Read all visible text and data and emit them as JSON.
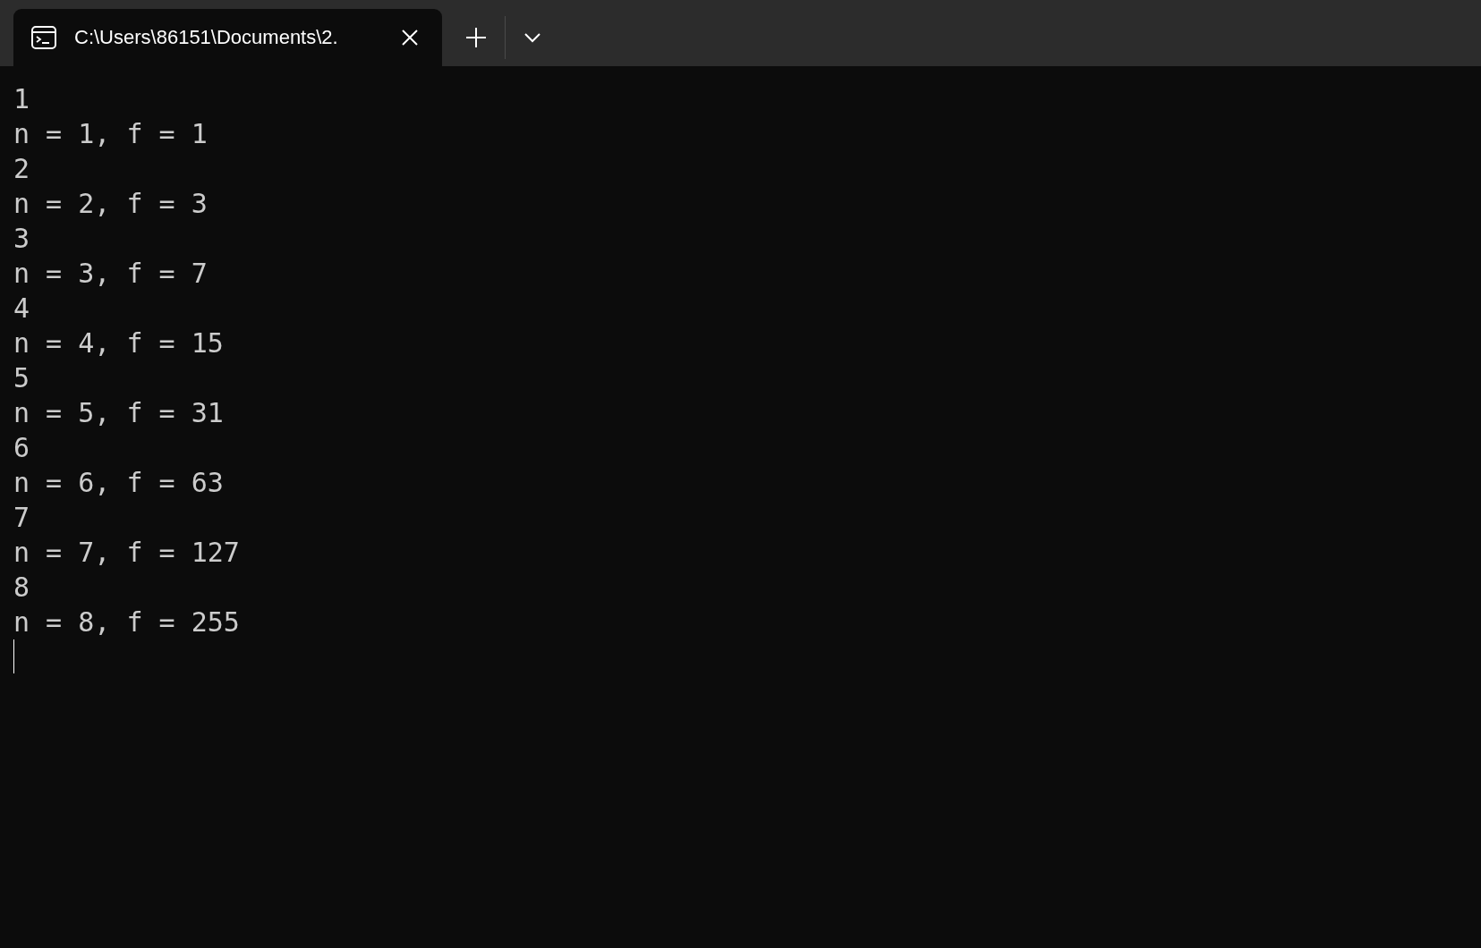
{
  "tab": {
    "title": "C:\\Users\\86151\\Documents\\2.",
    "selected": true
  },
  "output": [
    "1",
    "n = 1, f = 1",
    "2",
    "n = 2, f = 3",
    "3",
    "n = 3, f = 7",
    "4",
    "n = 4, f = 15",
    "5",
    "n = 5, f = 31",
    "6",
    "n = 6, f = 63",
    "7",
    "n = 7, f = 127",
    "8",
    "n = 8, f = 255"
  ]
}
